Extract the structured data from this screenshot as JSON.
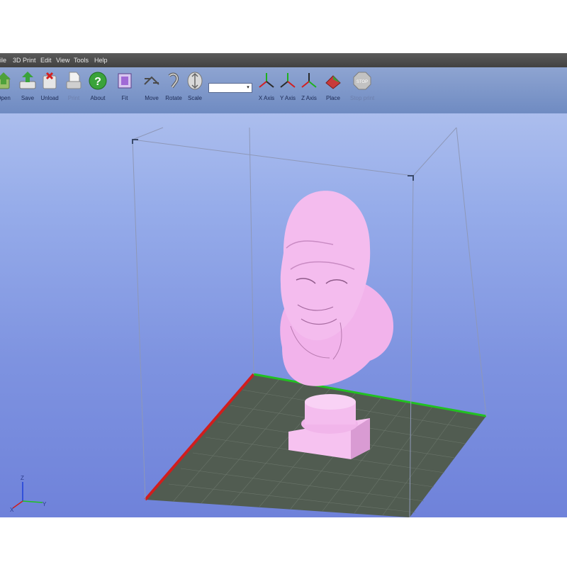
{
  "menu": [
    {
      "key": "file",
      "label": "ile"
    },
    {
      "key": "print3d",
      "label": "3D Print"
    },
    {
      "key": "edit",
      "label": "Edit"
    },
    {
      "key": "view",
      "label": "View"
    },
    {
      "key": "tools",
      "label": "Tools"
    },
    {
      "key": "help",
      "label": "Help"
    }
  ],
  "toolbar": {
    "open": "Open",
    "save": "Save",
    "unload": "Unload",
    "print": "Print",
    "about": "About",
    "fit": "Fit",
    "move": "Move",
    "rotate": "Rotate",
    "scale": "Scale",
    "x_axis": "X Axis",
    "y_axis": "Y Axis",
    "z_axis": "Z Axis",
    "place": "Place",
    "stop_print": "Stop print",
    "zoom_value": "",
    "stop_icon_text": "STOP"
  },
  "axes_indicator": {
    "z": "Z",
    "y": "Y",
    "x": "X"
  },
  "colors": {
    "viewport_top": "#b6c6ef",
    "viewport_bottom": "#6f82da",
    "bed": "#4f5a4f",
    "bed_grid": "#6a766a",
    "model": "#f3b8ee",
    "axis_x": "#d11d1d",
    "axis_y": "#1fc21f",
    "axis_z": "#1e3fd8"
  },
  "scene": {
    "object": "pink bust model on print bed"
  }
}
